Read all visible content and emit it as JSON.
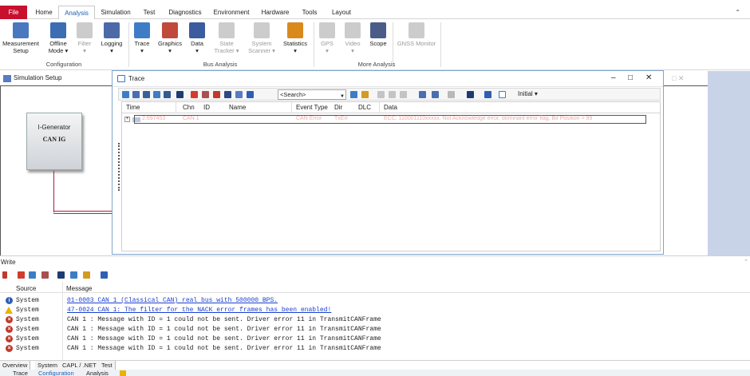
{
  "ribbon": {
    "tabs": [
      "File",
      "Home",
      "Analysis",
      "Simulation",
      "Test",
      "Diagnostics",
      "Environment",
      "Hardware",
      "Tools",
      "Layout"
    ],
    "active_tab": "Analysis",
    "collapse_glyph": "⌃",
    "configuration": {
      "label": "Configuration",
      "buttons": {
        "measurement_setup": [
          "Measurement",
          "Setup"
        ],
        "offline_mode": [
          "Offline",
          "Mode ▾"
        ],
        "filter": [
          "Filter",
          "▾"
        ],
        "logging": [
          "Logging",
          "▾"
        ]
      }
    },
    "bus_analysis": {
      "label": "Bus Analysis",
      "buttons": {
        "trace": [
          "Trace",
          "▾"
        ],
        "graphics": [
          "Graphics",
          "▾"
        ],
        "data": [
          "Data",
          "▾"
        ],
        "state_tracker": [
          "State",
          "Tracker ▾"
        ],
        "system_scanner": [
          "System",
          "Scanner ▾"
        ],
        "statistics": [
          "Statistics",
          "▾"
        ]
      }
    },
    "more_analysis": {
      "label": "More Analysis",
      "buttons": {
        "gps": [
          "GPS",
          "▾"
        ],
        "video": [
          "Video",
          "▾"
        ],
        "scope": [
          "Scope",
          ""
        ],
        "gnss_monitor": [
          "GNSS Monitor",
          ""
        ]
      }
    }
  },
  "simulation_setup": {
    "title": "Simulation Setup",
    "node": {
      "line1": "I-Generator",
      "line2": "CAN IG"
    }
  },
  "trace": {
    "title": "Trace",
    "controls": {
      "minimize": "–",
      "maximize": "□",
      "close": "✕"
    },
    "bg_controls": "□  ✕",
    "search_placeholder": "<Search>",
    "initial_label": "Initial ▾",
    "columns": [
      "Time",
      "Chn",
      "ID",
      "Name",
      "Event Type",
      "Dir",
      "DLC",
      "Data"
    ],
    "row": {
      "time": "2.697453",
      "chn": "CAN 1",
      "id": "",
      "name": "",
      "event_type": "CAN Error",
      "dir": "TxErr",
      "dlc": "",
      "data": "ECC: 110001110xxxxx, Not Acknowledge error, dominant error flag, Bit Position = 99"
    }
  },
  "write": {
    "title": "Write",
    "pin": "⌃",
    "columns": {
      "source": "Source",
      "message": "Message"
    },
    "rows": [
      {
        "level": "info",
        "source": "System",
        "message": "01-0003 CAN 1 (Classical CAN)  real bus with 500000 BPS.",
        "link": true
      },
      {
        "level": "warn",
        "source": "System",
        "message": "47-0024 CAN 1: The filter for the NACK error frames has been enabled!",
        "link": true
      },
      {
        "level": "err",
        "source": "System",
        "message": "CAN 1 : Message with ID = 1 could not be sent. Driver error 11 in TransmitCANFrame",
        "link": false
      },
      {
        "level": "err",
        "source": "System",
        "message": "CAN 1 : Message with ID = 1 could not be sent. Driver error 11 in TransmitCANFrame",
        "link": false
      },
      {
        "level": "err",
        "source": "System",
        "message": "CAN 1 : Message with ID = 1 could not be sent. Driver error 11 in TransmitCANFrame",
        "link": false
      },
      {
        "level": "err",
        "source": "System",
        "message": "CAN 1 : Message with ID = 1 could not be sent. Driver error 11 in TransmitCANFrame",
        "link": false
      }
    ],
    "tabs": [
      "Overview",
      "System",
      "CAPL / .NET",
      "Test"
    ]
  },
  "bottom_tabs": [
    "Trace",
    "Configuration",
    "Analysis"
  ],
  "colors": {
    "accent": "#1a5fb4",
    "file_tab": "#c8102e",
    "error_text": "#f3a8a8",
    "link": "#1a3fd1"
  }
}
